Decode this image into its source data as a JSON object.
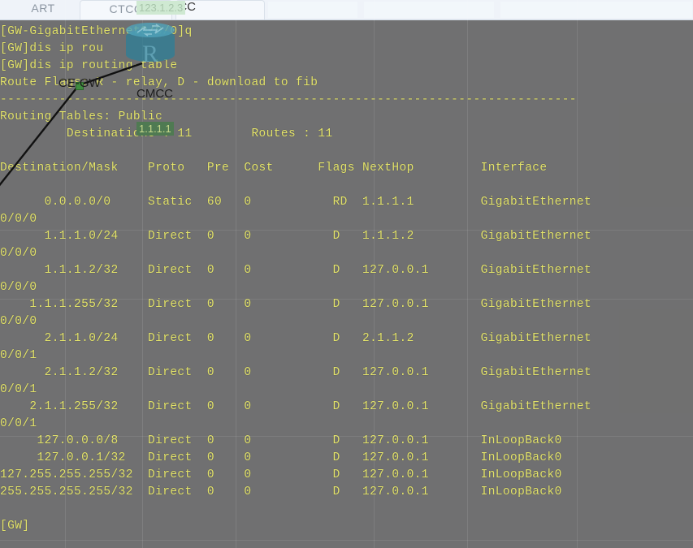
{
  "tabs": [
    {
      "label": "ART",
      "framed": false
    },
    {
      "label": "CTCC",
      "framed": true
    },
    {
      "label": "",
      "framed": true
    }
  ],
  "diagram": {
    "device_label": "CE-GW",
    "cloud_label": "CMCC",
    "cloud_label_top": "CMCC",
    "ip_chip_top": "123.1.2.3",
    "ip_chip_mid": "1.1.1.1",
    "router_letter": "R",
    "link_color": "#111111",
    "connector_color": "#3f8c3f",
    "router_color": "#2f7f96"
  },
  "terminal": {
    "background": "#666666",
    "foreground": "#e3e36a",
    "prompt_hostname": "GW",
    "lines": [
      "[GW-GigabitEthernet0/0/0]q",
      "[GW]dis ip rou",
      "[GW]dis ip routing-table",
      "Route Flags: R - relay, D - download to fib",
      "------------------------------------------------------------------------------",
      "Routing Tables: Public",
      "         Destinations : 11        Routes : 11",
      "",
      "Destination/Mask    Proto   Pre  Cost      Flags NextHop         Interface",
      "",
      "      0.0.0.0/0     Static  60   0           RD  1.1.1.1         GigabitEthernet",
      "0/0/0",
      "      1.1.1.0/24    Direct  0    0           D   1.1.1.2         GigabitEthernet",
      "0/0/0",
      "      1.1.1.2/32    Direct  0    0           D   127.0.0.1       GigabitEthernet",
      "0/0/0",
      "    1.1.1.255/32    Direct  0    0           D   127.0.0.1       GigabitEthernet",
      "0/0/0",
      "      2.1.1.0/24    Direct  0    0           D   2.1.1.2         GigabitEthernet",
      "0/0/1",
      "      2.1.1.2/32    Direct  0    0           D   127.0.0.1       GigabitEthernet",
      "0/0/1",
      "    2.1.1.255/32    Direct  0    0           D   127.0.0.1       GigabitEthernet",
      "0/0/1",
      "     127.0.0.0/8    Direct  0    0           D   127.0.0.1       InLoopBack0",
      "     127.0.0.1/32   Direct  0    0           D   127.0.0.1       InLoopBack0",
      "127.255.255.255/32  Direct  0    0           D   127.0.0.1       InLoopBack0",
      "255.255.255.255/32  Direct  0    0           D   127.0.0.1       InLoopBack0",
      "",
      "[GW]"
    ],
    "routing_table": {
      "flags_legend": "Route Flags: R - relay, D - download to fib",
      "table_scope": "Routing Tables: Public",
      "destinations_label": "Destinations",
      "destinations_count": "11",
      "routes_label": "Routes",
      "routes_count": "11",
      "columns": [
        "Destination/Mask",
        "Proto",
        "Pre",
        "Cost",
        "Flags",
        "NextHop",
        "Interface"
      ],
      "rows": [
        {
          "dest": "0.0.0.0/0",
          "proto": "Static",
          "pre": "60",
          "cost": "0",
          "flags": "RD",
          "nexthop": "1.1.1.1",
          "interface": "GigabitEthernet0/0/0"
        },
        {
          "dest": "1.1.1.0/24",
          "proto": "Direct",
          "pre": "0",
          "cost": "0",
          "flags": "D",
          "nexthop": "1.1.1.2",
          "interface": "GigabitEthernet0/0/0"
        },
        {
          "dest": "1.1.1.2/32",
          "proto": "Direct",
          "pre": "0",
          "cost": "0",
          "flags": "D",
          "nexthop": "127.0.0.1",
          "interface": "GigabitEthernet0/0/0"
        },
        {
          "dest": "1.1.1.255/32",
          "proto": "Direct",
          "pre": "0",
          "cost": "0",
          "flags": "D",
          "nexthop": "127.0.0.1",
          "interface": "GigabitEthernet0/0/0"
        },
        {
          "dest": "2.1.1.0/24",
          "proto": "Direct",
          "pre": "0",
          "cost": "0",
          "flags": "D",
          "nexthop": "2.1.1.2",
          "interface": "GigabitEthernet0/0/1"
        },
        {
          "dest": "2.1.1.2/32",
          "proto": "Direct",
          "pre": "0",
          "cost": "0",
          "flags": "D",
          "nexthop": "127.0.0.1",
          "interface": "GigabitEthernet0/0/1"
        },
        {
          "dest": "2.1.1.255/32",
          "proto": "Direct",
          "pre": "0",
          "cost": "0",
          "flags": "D",
          "nexthop": "127.0.0.1",
          "interface": "GigabitEthernet0/0/1"
        },
        {
          "dest": "127.0.0.0/8",
          "proto": "Direct",
          "pre": "0",
          "cost": "0",
          "flags": "D",
          "nexthop": "127.0.0.1",
          "interface": "InLoopBack0"
        },
        {
          "dest": "127.0.0.1/32",
          "proto": "Direct",
          "pre": "0",
          "cost": "0",
          "flags": "D",
          "nexthop": "127.0.0.1",
          "interface": "InLoopBack0"
        },
        {
          "dest": "127.255.255.255/32",
          "proto": "Direct",
          "pre": "0",
          "cost": "0",
          "flags": "D",
          "nexthop": "127.0.0.1",
          "interface": "InLoopBack0"
        },
        {
          "dest": "255.255.255.255/32",
          "proto": "Direct",
          "pre": "0",
          "cost": "0",
          "flags": "D",
          "nexthop": "127.0.0.1",
          "interface": "InLoopBack0"
        }
      ]
    },
    "commands_entered": [
      "q",
      "dis ip rou",
      "dis ip routing-table"
    ]
  }
}
